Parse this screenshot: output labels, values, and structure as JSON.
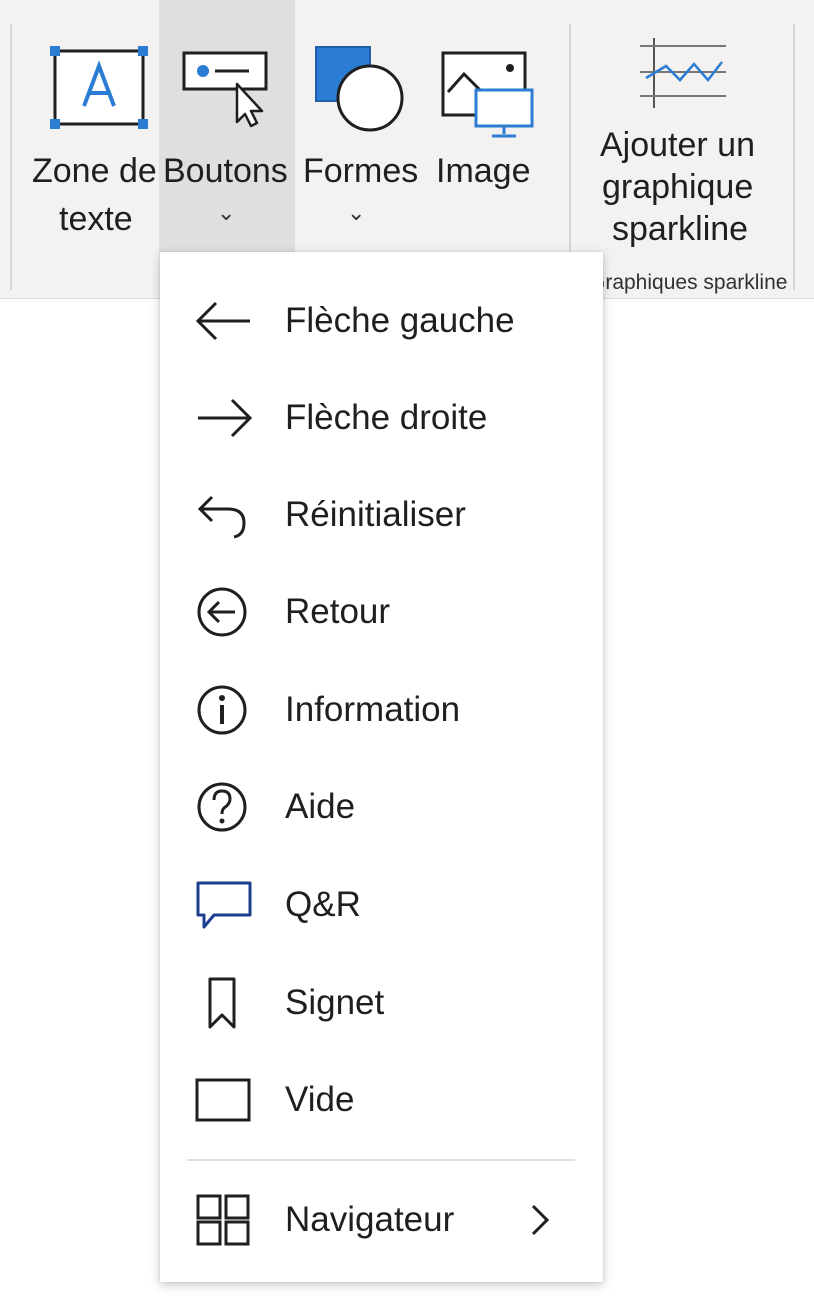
{
  "ribbon": {
    "buttons": [
      {
        "label_line1": "Zone de",
        "label_line2": "texte"
      },
      {
        "label": "Boutons",
        "chevron": "⌄"
      },
      {
        "label": "Formes",
        "chevron": "⌄"
      },
      {
        "label": "Image"
      }
    ],
    "sparkline": {
      "label_line1": "Ajouter un",
      "label_line2": "graphique",
      "label_line3": "sparkline",
      "group_label": "Graphiques sparkline"
    }
  },
  "menu": {
    "items": [
      {
        "label": "Flèche gauche",
        "icon": "arrow-left-icon"
      },
      {
        "label": "Flèche droite",
        "icon": "arrow-right-icon"
      },
      {
        "label": "Réinitialiser",
        "icon": "reset-icon"
      },
      {
        "label": "Retour",
        "icon": "back-circle-icon"
      },
      {
        "label": "Information",
        "icon": "info-icon"
      },
      {
        "label": "Aide",
        "icon": "help-icon"
      },
      {
        "label": "Q&R",
        "icon": "qna-icon"
      },
      {
        "label": "Signet",
        "icon": "bookmark-icon"
      },
      {
        "label": "Vide",
        "icon": "blank-icon"
      }
    ],
    "navigator": {
      "label": "Navigateur",
      "icon": "navigator-icon",
      "submenu_icon": "chevron-right-icon"
    }
  },
  "colors": {
    "accent_blue": "#2b7cd3",
    "qna_blue": "#1d3f8f",
    "ribbon_bg": "#f3f2f1",
    "selected_bg": "#e1dfdd"
  }
}
